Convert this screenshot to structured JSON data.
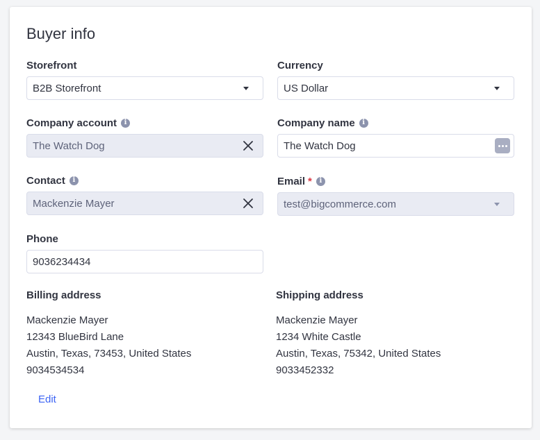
{
  "section": {
    "title": "Buyer info"
  },
  "storefront": {
    "label": "Storefront",
    "value": "B2B Storefront"
  },
  "currency": {
    "label": "Currency",
    "value": "US Dollar"
  },
  "company_account": {
    "label": "Company account",
    "value": "The Watch Dog"
  },
  "company_name": {
    "label": "Company name",
    "value": "The Watch Dog"
  },
  "contact": {
    "label": "Contact",
    "value": "Mackenzie Mayer"
  },
  "email": {
    "label": "Email",
    "required_mark": "*",
    "value": "test@bigcommerce.com"
  },
  "phone": {
    "label": "Phone",
    "value": "9036234434"
  },
  "billing": {
    "title": "Billing address",
    "lines": [
      "Mackenzie Mayer",
      "12343 BlueBird Lane",
      "Austin, Texas, 73453, United States",
      "9034534534"
    ]
  },
  "shipping": {
    "title": "Shipping address",
    "lines": [
      "Mackenzie Mayer",
      "1234 White Castle",
      "Austin, Texas, 75342, United States",
      "9033452332"
    ]
  },
  "actions": {
    "edit_label": "Edit"
  },
  "icons": {
    "info": "info-icon",
    "clear": "close-icon",
    "dropdown": "chevron-down-icon",
    "more": "more-horizontal-icon"
  },
  "colors": {
    "link": "#3c64f4",
    "required": "#db3643",
    "disabled_bg": "#e9ebf3",
    "border": "#d9dce9"
  }
}
